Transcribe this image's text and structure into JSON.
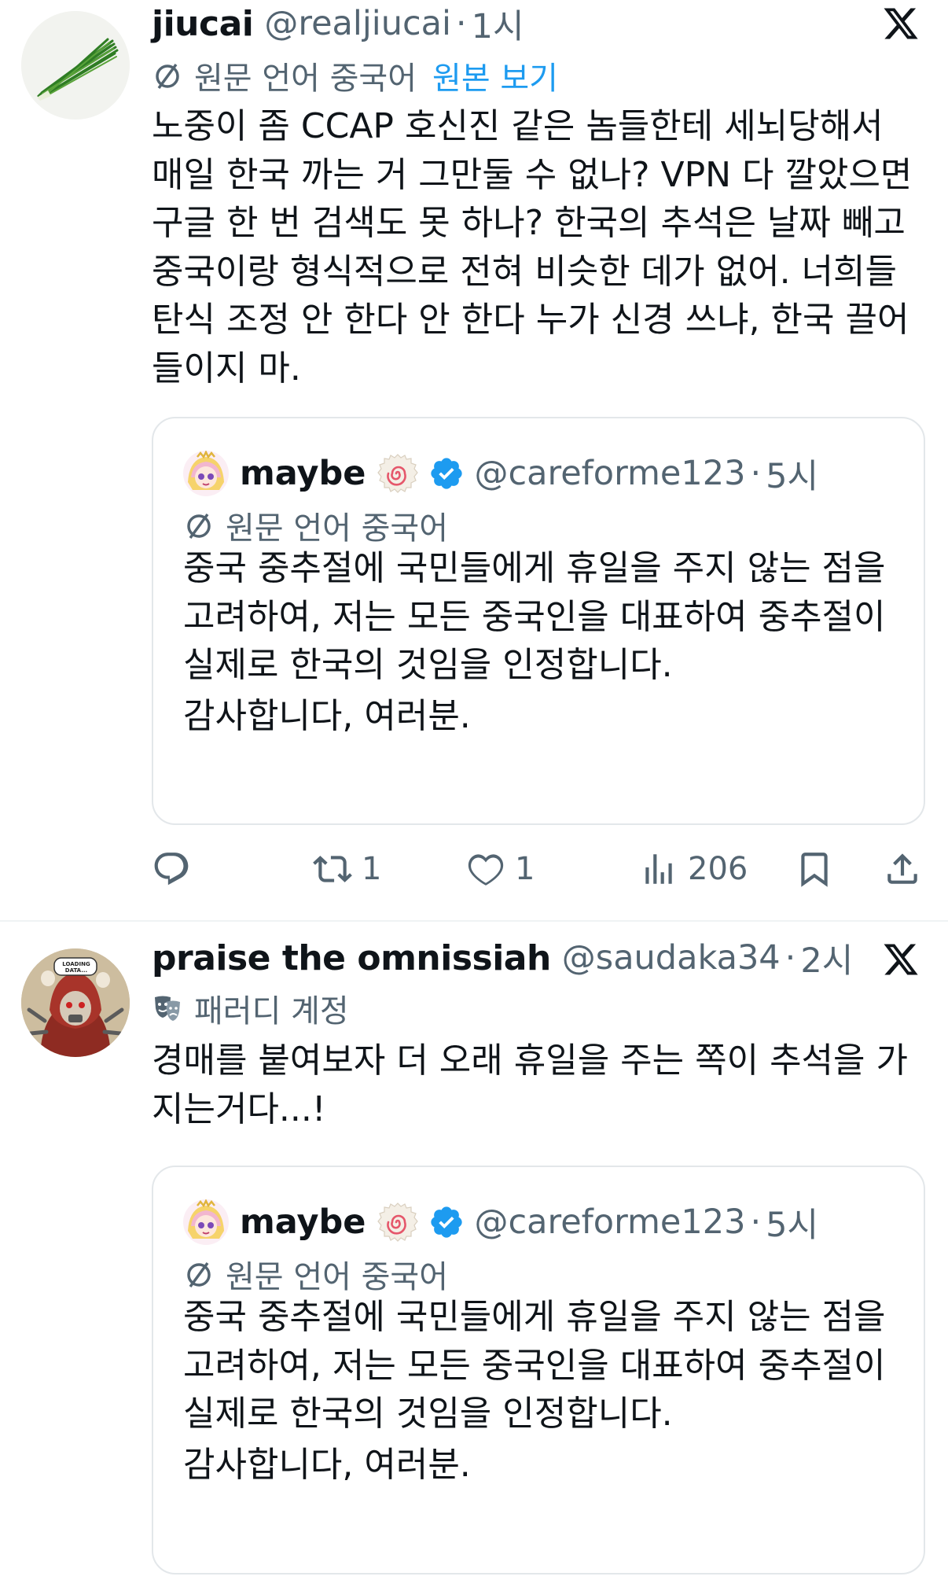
{
  "tweets": [
    {
      "name": "jiucai",
      "handle": "@realjiucai",
      "separator": "·",
      "time": "1시",
      "translated_label": "원문 언어 중국어",
      "show_original": "원본 보기",
      "body": "노중이 좀 CCAP 호신진 같은 놈들한테 세뇌당해서\n매일 한국 까는 거 그만둘 수 없나? VPN 다 깔았으면\n구글 한 번 검색도 못 하나? 한국의 추석은 날짜 빼고\n중국이랑 형식적으로 전혀 비슷한 데가 없어. 너희들\n탄식 조정 안 한다 안 한다 누가 신경 쓰냐, 한국 끌어\n들이지 마.",
      "avatar_icon": "chives-icon",
      "quote": {
        "name": "maybe",
        "handle": "@careforme123",
        "separator": "·",
        "time": "5시",
        "translated_label": "원문 언어 중국어",
        "body": "중국 중추절에 국민들에게 휴일을 주지 않는 점을\n고려하여, 저는 모든 중국인을 대표하여 중추절이\n실제로 한국의 것임을 인정합니다.",
        "thanks": "감사합니다, 여러분."
      },
      "actions": {
        "reply_count": "",
        "retweet_count": "1",
        "like_count": "1",
        "view_count": "206"
      }
    },
    {
      "name": "praise the omnissiah",
      "handle": "@saudaka34",
      "separator": "·",
      "time": "2시",
      "parody_label": "패러디 계정",
      "body": "경매를 붙여보자 더 오래 휴일을 주는 쪽이 추석을 가\n지는거다...!",
      "avatar_icon": "robot-avatar-icon",
      "avatar_text": "LOADING DATA...",
      "quote": {
        "name": "maybe",
        "handle": "@careforme123",
        "separator": "·",
        "time": "5시",
        "translated_label": "원문 언어 중국어",
        "body": "중국 중추절에 국민들에게 휴일을 주지 않는 점을\n고려하여, 저는 모든 중국인을 대표하여 중추절이\n실제로 한국의 것임을 인정합니다.",
        "thanks": "감사합니다, 여러분."
      }
    }
  ],
  "colors": {
    "text": "#0f1419",
    "secondary": "#536471",
    "link": "#1d9bf0",
    "border": "#e3e7ea"
  }
}
